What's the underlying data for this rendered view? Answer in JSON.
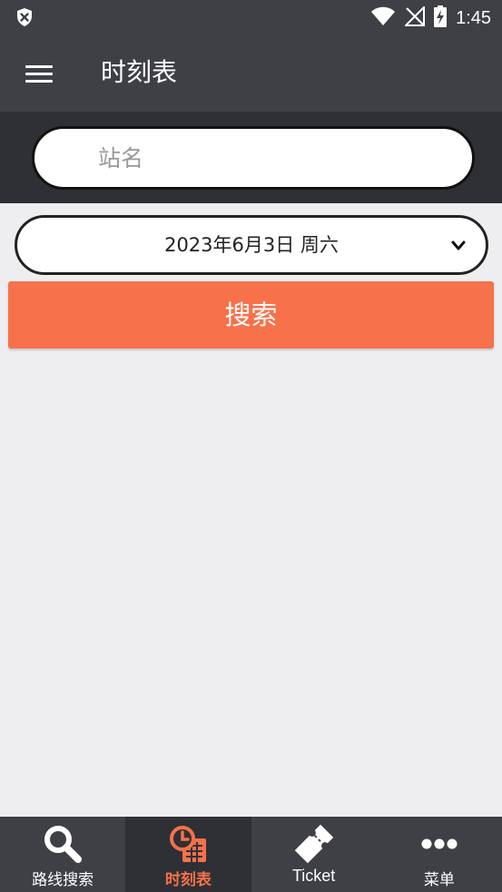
{
  "status_bar": {
    "time": "1:45"
  },
  "app_bar": {
    "title": "时刻表"
  },
  "station_search": {
    "placeholder": "站名",
    "value": ""
  },
  "date_selector": {
    "selected_date": "2023年6月3日 周六"
  },
  "search_button": {
    "label": "搜索"
  },
  "bottom_nav": {
    "items": [
      {
        "label": "路线搜索",
        "icon": "search-icon",
        "active": false
      },
      {
        "label": "时刻表",
        "icon": "timetable-icon",
        "active": true
      },
      {
        "label": "Ticket",
        "icon": "ticket-icon",
        "active": false
      },
      {
        "label": "菜单",
        "icon": "more-icon",
        "active": false
      }
    ]
  },
  "colors": {
    "bar_bg": "#3f4046",
    "bar_dark": "#2f3035",
    "accent": "#f7714a",
    "page_bg": "#eeeef1"
  }
}
